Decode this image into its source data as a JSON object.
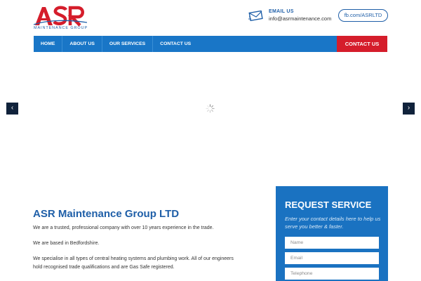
{
  "header": {
    "logo_text": "ASR",
    "logo_subtitle": "MAINTENANCE GROUP",
    "email_label": "EMAIL US",
    "email_value": "info@asrmaintenance.com",
    "facebook_label": "fb.com/ASRLTD"
  },
  "nav": {
    "items": [
      {
        "label": "HOME"
      },
      {
        "label": "ABOUT US"
      },
      {
        "label": "OUR SERVICES"
      },
      {
        "label": "CONTACT US"
      }
    ],
    "cta_label": "CONTACT US"
  },
  "hero": {
    "prev_glyph": "‹",
    "next_glyph": "›"
  },
  "content": {
    "title": "ASR Maintenance Group LTD",
    "paragraphs": [
      "We are a trusted, professional company with over 10 years experience in the trade.",
      "We are based in Bedfordshire.",
      "We specialise in all types of central heating systems and plumbing work. All of our engineers hold recognised trade qualifications and are Gas Safe registered."
    ]
  },
  "request_service": {
    "title": "REQUEST SERVICE",
    "subtitle": "Enter your contact details here to help us serve you better & faster.",
    "fields": [
      {
        "placeholder": "Name"
      },
      {
        "placeholder": "Email"
      },
      {
        "placeholder": "Telephone"
      }
    ]
  },
  "colors": {
    "brand_blue": "#1976c7",
    "brand_red": "#d51d2b",
    "hero_dark": "#0b2f68",
    "hero_teal": "#0c7a9a"
  }
}
